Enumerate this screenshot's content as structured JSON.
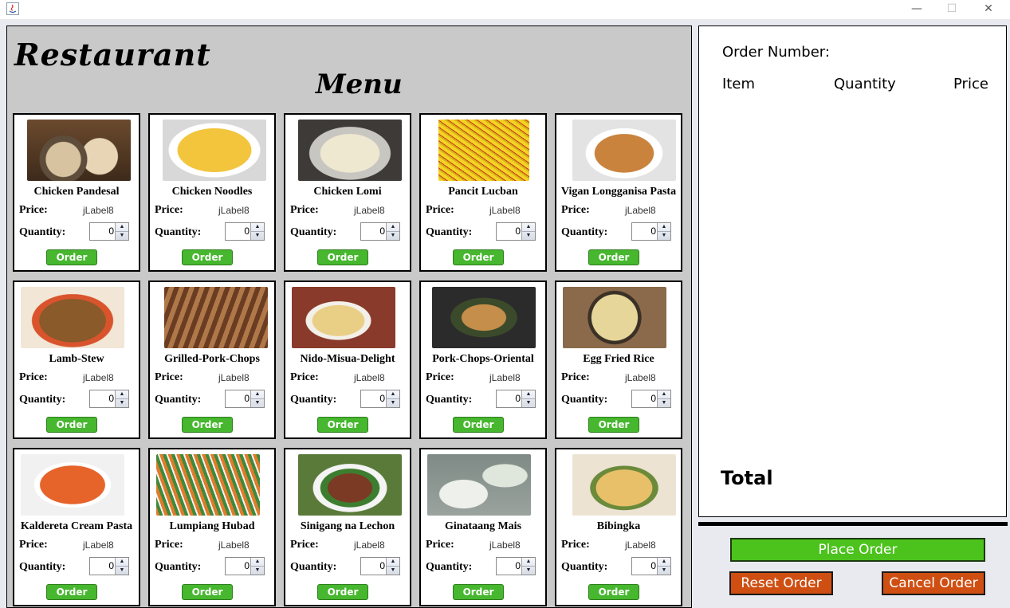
{
  "window": {
    "minimize": "—",
    "maximize": "☐",
    "close": "✕"
  },
  "titles": {
    "restaurant": "Restaurant",
    "menu": "Menu"
  },
  "labels": {
    "price": "Price:",
    "quantity": "Quantity:",
    "order": "Order"
  },
  "items": [
    {
      "name": "Chicken Pandesal",
      "price": "jLabel8",
      "quantity": "0"
    },
    {
      "name": "Chicken Noodles",
      "price": "jLabel8",
      "quantity": "0"
    },
    {
      "name": "Chicken Lomi",
      "price": "jLabel8",
      "quantity": "0"
    },
    {
      "name": "Pancit Lucban",
      "price": "jLabel8",
      "quantity": "0"
    },
    {
      "name": "Vigan Longganisa Pasta",
      "price": "jLabel8",
      "quantity": "0"
    },
    {
      "name": "Lamb-Stew",
      "price": "jLabel8",
      "quantity": "0"
    },
    {
      "name": "Grilled-Pork-Chops",
      "price": "jLabel8",
      "quantity": "0"
    },
    {
      "name": "Nido-Misua-Delight",
      "price": "jLabel8",
      "quantity": "0"
    },
    {
      "name": "Pork-Chops-Oriental",
      "price": "jLabel8",
      "quantity": "0"
    },
    {
      "name": "Egg Fried Rice",
      "price": "jLabel8",
      "quantity": "0"
    },
    {
      "name": "Kaldereta Cream Pasta",
      "price": "jLabel8",
      "quantity": "0"
    },
    {
      "name": "Lumpiang Hubad",
      "price": "jLabel8",
      "quantity": "0"
    },
    {
      "name": "Sinigang na Lechon",
      "price": "jLabel8",
      "quantity": "0"
    },
    {
      "name": "Ginataang Mais",
      "price": "jLabel8",
      "quantity": "0"
    },
    {
      "name": "Bibingka",
      "price": "jLabel8",
      "quantity": "0"
    }
  ],
  "order_panel": {
    "order_number_label": "Order Number:",
    "col_item": "Item",
    "col_quantity": "Quantity",
    "col_price": "Price",
    "total_label": "Total"
  },
  "actions": {
    "place_order": "Place Order",
    "reset_order": "Reset Order",
    "cancel_order": "Cancel Order"
  },
  "colors": {
    "order_green": "#46b72e",
    "place_green": "#4cc31d",
    "reset_orange": "#cf4f12",
    "panel_gray": "#c9c9c9"
  }
}
